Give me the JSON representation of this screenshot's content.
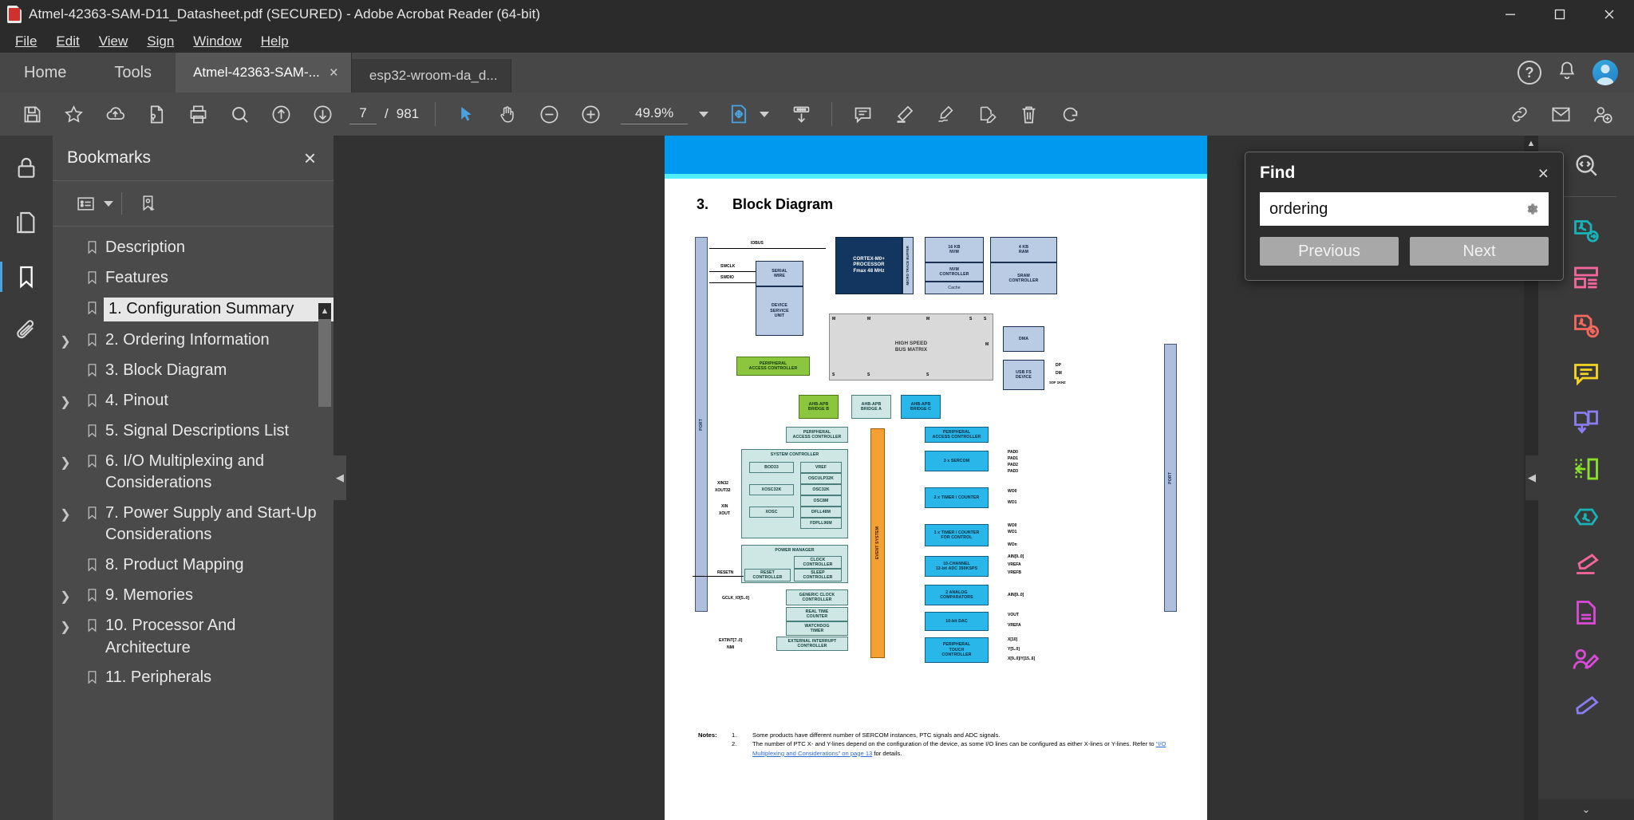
{
  "window": {
    "title": "Atmel-42363-SAM-D11_Datasheet.pdf (SECURED) - Adobe Acrobat Reader (64-bit)",
    "minimize_label": "Minimize",
    "maximize_label": "Maximize",
    "close_label": "Close"
  },
  "menubar": {
    "items": [
      {
        "label": "File"
      },
      {
        "label": "Edit"
      },
      {
        "label": "View"
      },
      {
        "label": "Sign"
      },
      {
        "label": "Window"
      },
      {
        "label": "Help"
      }
    ]
  },
  "tabstrip": {
    "home_label": "Home",
    "tools_label": "Tools",
    "tabs": [
      {
        "label": "Atmel-42363-SAM-...",
        "close": "×",
        "active": true
      },
      {
        "label": "esp32-wroom-da_d...",
        "close": "",
        "active": false
      }
    ],
    "help_label": "?"
  },
  "toolbar": {
    "page_current": "7",
    "page_separator": "/",
    "page_total": "981",
    "zoom_value": "49.9%",
    "icons": [
      "save-icon",
      "star-icon",
      "cloud-upload-icon",
      "secure-file-icon",
      "print-icon",
      "search-icon",
      "page-up-icon",
      "page-down-icon",
      "select-tool-icon",
      "hand-tool-icon",
      "zoom-out-icon",
      "zoom-in-icon",
      "fit-page-icon",
      "download-icon",
      "comment-icon",
      "highlight-icon",
      "sign-icon",
      "edit-pdf-icon",
      "delete-page-icon",
      "rotate-icon",
      "share-link-icon",
      "email-icon",
      "person-add-icon"
    ]
  },
  "bookmarks": {
    "panel_title": "Bookmarks",
    "close_label": "×",
    "options_icon": "bookmark-options-icon",
    "new_bookmark_icon": "new-bookmark-icon",
    "items": [
      {
        "label": "Description",
        "expandable": false,
        "selected": false
      },
      {
        "label": "Features",
        "expandable": false,
        "selected": false
      },
      {
        "label": "1. Configuration Summary",
        "expandable": false,
        "selected": true
      },
      {
        "label": "2. Ordering Information",
        "expandable": true,
        "selected": false
      },
      {
        "label": "3. Block Diagram",
        "expandable": false,
        "selected": false
      },
      {
        "label": "4. Pinout",
        "expandable": true,
        "selected": false
      },
      {
        "label": "5. Signal Descriptions List",
        "expandable": false,
        "selected": false
      },
      {
        "label": "6. I/O Multiplexing and Considerations",
        "expandable": true,
        "selected": false
      },
      {
        "label": "7. Power Supply and Start-Up Considerations",
        "expandable": true,
        "selected": false
      },
      {
        "label": "8. Product Mapping",
        "expandable": false,
        "selected": false
      },
      {
        "label": "9. Memories",
        "expandable": true,
        "selected": false
      },
      {
        "label": "10. Processor And Architecture",
        "expandable": true,
        "selected": false
      },
      {
        "label": "11. Peripherals",
        "expandable": false,
        "selected": false
      }
    ]
  },
  "find": {
    "title": "Find",
    "close_label": "×",
    "query": "ordering",
    "placeholder": "Find",
    "settings_icon": "gear-icon",
    "previous_label": "Previous",
    "next_label": "Next"
  },
  "document": {
    "section_number": "3.",
    "section_title": "Block Diagram",
    "header_band_color": "#0099f0",
    "accent_band_color": "#4ff0fb",
    "notes_label": "Notes:",
    "notes": [
      {
        "num": "1.",
        "text": "Some products have different number of SERCOM instances, PTC signals and ADC signals.",
        "link": "",
        "tail": ""
      },
      {
        "num": "2.",
        "text": "The number of PTC X- and Y-lines depend on the configuration of the device, as some I/O lines can be configured as either X-lines or Y-lines. Refer to ",
        "link": "“I/O Multiplexing and Considerations” on page 13",
        "tail": " for details."
      }
    ],
    "diagram": {
      "title": "SAM D11 Block Diagram",
      "blocks": [
        {
          "id": "port-left",
          "label": "PORT",
          "style": "b-port"
        },
        {
          "id": "port-right",
          "label": "PORT",
          "style": "b-port"
        },
        {
          "id": "serial-wire",
          "label": "SERIAL\nWIRE",
          "style": "b-light"
        },
        {
          "id": "device-service-unit",
          "label": "DEVICE\nSERVICE\nUNIT",
          "style": "b-light"
        },
        {
          "id": "cortex-m0",
          "label": "CORTEX-M0+\nPROCESSOR\nFmax 48 MHz",
          "style": "b-dark"
        },
        {
          "id": "micro-trace-buffer",
          "label": "MICRO TRACE BUFFER",
          "style": "b-light"
        },
        {
          "id": "nvm-16kb",
          "label": "16 KB\nNVM",
          "style": "b-light"
        },
        {
          "id": "nvm-controller",
          "label": "NVM\nCONTROLLER",
          "style": "b-light"
        },
        {
          "id": "cache",
          "label": "Cache",
          "style": "b-light"
        },
        {
          "id": "ram-4kb",
          "label": "4 KB\nRAM",
          "style": "b-light"
        },
        {
          "id": "sram-controller",
          "label": "SRAM\nCONTROLLER",
          "style": "b-light"
        },
        {
          "id": "bus-matrix",
          "label": "HIGH SPEED\nBUS MATRIX",
          "style": "b-grey"
        },
        {
          "id": "dma",
          "label": "DMA",
          "style": "b-light"
        },
        {
          "id": "usb-fs-device",
          "label": "USB FS\nDEVICE",
          "style": "b-light"
        },
        {
          "id": "pac-b",
          "label": "PERIPHERAL\nACCESS CONTROLLER",
          "style": "b-green"
        },
        {
          "id": "ahb-apb-bridge-b",
          "label": "AHB-APB\nBRIDGE B",
          "style": "b-green"
        },
        {
          "id": "ahb-apb-bridge-a",
          "label": "AHB-APB\nBRIDGE A",
          "style": "b-mint"
        },
        {
          "id": "ahb-apb-bridge-c",
          "label": "AHB-APB\nBRIDGE C",
          "style": "b-cyan"
        },
        {
          "id": "pac-a",
          "label": "PERIPHERAL\nACCESS CONTROLLER",
          "style": "b-mint"
        },
        {
          "id": "pac-c",
          "label": "PERIPHERAL\nACCESS CONTROLLER",
          "style": "b-cyan"
        },
        {
          "id": "system-controller",
          "label": "SYSTEM CONTROLLER",
          "style": "b-mint"
        },
        {
          "id": "bod33",
          "label": "BOD33",
          "style": "b-mint"
        },
        {
          "id": "vref",
          "label": "VREF",
          "style": "b-mint"
        },
        {
          "id": "osculp32k",
          "label": "OSCULP32K",
          "style": "b-mint"
        },
        {
          "id": "xosc32k",
          "label": "XOSC32K",
          "style": "b-mint"
        },
        {
          "id": "osc32k",
          "label": "OSC32K",
          "style": "b-mint"
        },
        {
          "id": "osc8m",
          "label": "OSC8M",
          "style": "b-mint"
        },
        {
          "id": "xosc",
          "label": "XOSC",
          "style": "b-mint"
        },
        {
          "id": "dfll48m",
          "label": "DFLL48M",
          "style": "b-mint"
        },
        {
          "id": "fdpll96m",
          "label": "FDPLL96M",
          "style": "b-mint"
        },
        {
          "id": "power-manager",
          "label": "POWER MANAGER",
          "style": "b-mint"
        },
        {
          "id": "clock-controller",
          "label": "CLOCK\nCONTROLLER",
          "style": "b-mint"
        },
        {
          "id": "reset-controller",
          "label": "RESET\nCONTROLLER",
          "style": "b-mint"
        },
        {
          "id": "sleep-controller",
          "label": "SLEEP\nCONTROLLER",
          "style": "b-mint"
        },
        {
          "id": "generic-clock-controller",
          "label": "GENERIC CLOCK\nCONTROLLER",
          "style": "b-mint"
        },
        {
          "id": "real-time-counter",
          "label": "REAL TIME\nCOUNTER",
          "style": "b-mint"
        },
        {
          "id": "watchdog-timer",
          "label": "WATCHDOG\nTIMER",
          "style": "b-mint"
        },
        {
          "id": "external-interrupt-controller",
          "label": "EXTERNAL INTERRUPT\nCONTROLLER",
          "style": "b-mint"
        },
        {
          "id": "event-system",
          "label": "EVENT SYSTEM",
          "style": "b-orange"
        },
        {
          "id": "sercom",
          "label": "3 x SERCOM",
          "style": "b-cyan"
        },
        {
          "id": "timer-counter",
          "label": "2 x TIMER / COUNTER",
          "style": "b-cyan"
        },
        {
          "id": "timer-counter-control",
          "label": "1 x TIMER / COUNTER\nFOR CONTROL",
          "style": "b-cyan"
        },
        {
          "id": "adc",
          "label": "10-CHANNEL\n12-bit ADC 350KSPS",
          "style": "b-cyan"
        },
        {
          "id": "analog-comparators",
          "label": "2 ANALOG\nCOMPARATORS",
          "style": "b-cyan"
        },
        {
          "id": "dac",
          "label": "10-bit DAC",
          "style": "b-cyan"
        },
        {
          "id": "ptc",
          "label": "PERIPHERAL\nTOUCH\nCONTROLLER",
          "style": "b-cyan"
        }
      ],
      "signals": [
        "IOBUS",
        "SWCLK",
        "SWDIO",
        "M",
        "S",
        "DP",
        "DM",
        "SOF 1KHZ",
        "XIN32",
        "XOUT32",
        "XIN",
        "XOUT",
        "RESETN",
        "GCLK_IO[5..0]",
        "EXTINT[7..0]",
        "NMI",
        "PAD0",
        "PAD1",
        "PAD2",
        "PAD3",
        "WO0",
        "WO1",
        "WOn",
        "AIN[9..0]",
        "VREFA",
        "VREFB",
        "VOUT",
        "X[10]",
        "Y[5..0]",
        "X[9..0]/Y[15..6]",
        "DMA"
      ]
    }
  },
  "rightrail": {
    "icons": [
      {
        "name": "search-compare-icon",
        "color": "#d0d0d0"
      },
      {
        "name": "export-pdf-icon",
        "color": "#17b3b8"
      },
      {
        "name": "organize-pages-icon",
        "color": "#f5679c"
      },
      {
        "name": "create-pdf-icon",
        "color": "#f4685e"
      },
      {
        "name": "comment-icon",
        "color": "#f4d522"
      },
      {
        "name": "combine-files-icon",
        "color": "#8a7df0"
      },
      {
        "name": "compress-pdf-icon",
        "color": "#8ae22a"
      },
      {
        "name": "protect-pdf-icon",
        "color": "#17b3b8"
      },
      {
        "name": "fill-sign-icon",
        "color": "#f5679c"
      },
      {
        "name": "edit-pdf-icon",
        "color": "#d94ad6"
      },
      {
        "name": "request-signatures-icon",
        "color": "#d94ad6"
      },
      {
        "name": "stamp-icon",
        "color": "#8a7df0"
      }
    ],
    "collapse_label": "⌄"
  },
  "leftrail": {
    "icons": [
      {
        "name": "security-lock-icon",
        "active": false
      },
      {
        "name": "page-thumbnails-icon",
        "active": false
      },
      {
        "name": "bookmarks-icon",
        "active": true
      },
      {
        "name": "attachments-icon",
        "active": false
      }
    ]
  }
}
